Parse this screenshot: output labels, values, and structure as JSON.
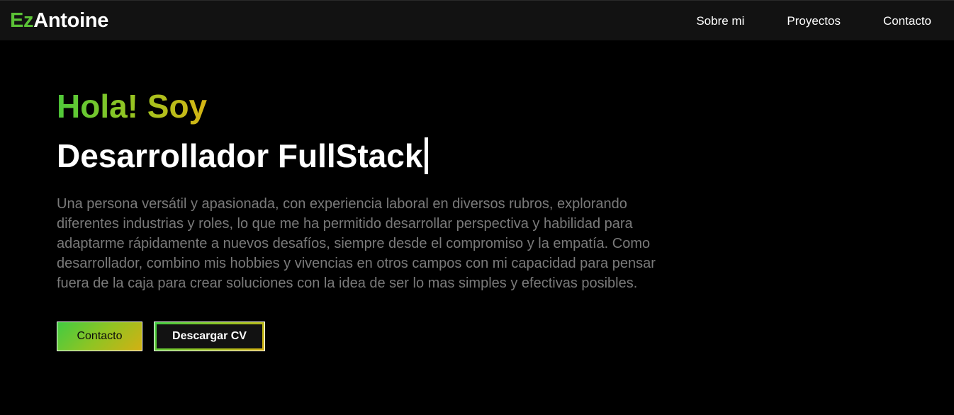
{
  "brand": {
    "prefix": "Ez",
    "name": "Antoine"
  },
  "nav": {
    "items": [
      {
        "label": "Sobre mi"
      },
      {
        "label": "Proyectos"
      },
      {
        "label": "Contacto"
      }
    ]
  },
  "hero": {
    "greeting": "Hola! Soy",
    "role": "Desarrollador FullStack",
    "description": "Una persona versátil y apasionada, con experiencia laboral en diversos rubros, explorando diferentes industrias y roles, lo que me ha permitido desarrollar perspectiva y habilidad para adaptarme rápidamente a nuevos desafíos, siempre desde el compromiso y la empatía. Como desarrollador, combino mis hobbies y vivencias en otros campos con mi capacidad para pensar fuera de la caja para crear soluciones con la idea de ser lo mas simples y efectivas posibles.",
    "buttons": {
      "contact_label": "Contacto",
      "cv_label": "Descargar CV"
    }
  },
  "colors": {
    "accent_green": "#5bc236",
    "accent_yellow": "#d7b514",
    "background": "#000000",
    "navbar": "#121212",
    "text_muted": "#7a7a7a"
  }
}
